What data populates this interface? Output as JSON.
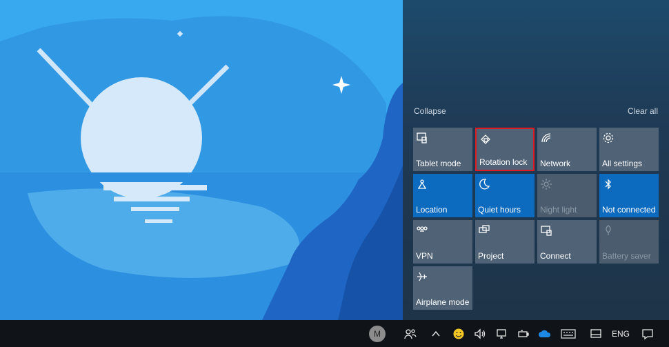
{
  "action_center": {
    "collapse_label": "Collapse",
    "clear_all_label": "Clear all",
    "tiles": [
      {
        "label": "Tablet mode",
        "icon": "tablet-mode-icon",
        "state": "off"
      },
      {
        "label": "Rotation lock",
        "icon": "rotation-lock-icon",
        "state": "off",
        "highlighted": true
      },
      {
        "label": "Network",
        "icon": "network-icon",
        "state": "off"
      },
      {
        "label": "All settings",
        "icon": "gear-icon",
        "state": "off"
      },
      {
        "label": "Location",
        "icon": "location-icon",
        "state": "on"
      },
      {
        "label": "Quiet hours",
        "icon": "moon-icon",
        "state": "on"
      },
      {
        "label": "Night light",
        "icon": "sun-icon",
        "state": "disabled"
      },
      {
        "label": "Not connected",
        "icon": "bluetooth-icon",
        "state": "on"
      },
      {
        "label": "VPN",
        "icon": "vpn-icon",
        "state": "off"
      },
      {
        "label": "Project",
        "icon": "project-icon",
        "state": "off"
      },
      {
        "label": "Connect",
        "icon": "connect-icon",
        "state": "off"
      },
      {
        "label": "Battery saver",
        "icon": "battery-saver-icon",
        "state": "disabled"
      },
      {
        "label": "Airplane mode",
        "icon": "airplane-icon",
        "state": "off"
      }
    ]
  },
  "taskbar": {
    "avatar_initial": "M",
    "language": "ENG"
  },
  "colors": {
    "tile_on": "#0d6bbf",
    "tile_off": "#4f6276",
    "highlight": "#e01b24",
    "taskbar": "#101418"
  }
}
